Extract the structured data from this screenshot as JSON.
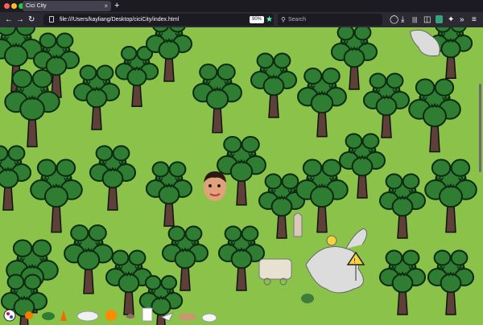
{
  "browser": {
    "tab_title": "Cici City",
    "tab_close": "×",
    "new_tab": "+",
    "url": "file:///Users/kayliang/Desktop/ciciCity/index.html",
    "zoom": "90%",
    "search_placeholder": "Search"
  },
  "icons": {
    "back": "back-arrow-icon",
    "forward": "forward-arrow-icon",
    "reload": "reload-icon",
    "page": "page-icon",
    "star": "bookmark-star-icon",
    "search": "search-icon",
    "pocket": "pocket-icon",
    "downloads": "download-icon",
    "library": "library-icon",
    "sidebar": "sidebar-icon",
    "extensions": "extension-icon",
    "overflow": "overflow-chevron-icon",
    "menu": "hamburger-menu-icon"
  },
  "colors": {
    "grass": "#8bc34a",
    "tree_leaf": "#2e7d32",
    "tree_trunk": "#5d4037",
    "chrome_dark": "#1c1b22"
  },
  "toolbar_items": [
    "ball-tool-icon",
    "sun-tool-icon",
    "turtle-tool-icon",
    "cone-tool-icon",
    "cloud-tool-icon",
    "orange-tool-icon",
    "bird-tool-icon",
    "paper-tool-icon",
    "plane-tool-icon",
    "dog-tool-icon",
    "whale-tool-icon"
  ],
  "sign_text": "!"
}
